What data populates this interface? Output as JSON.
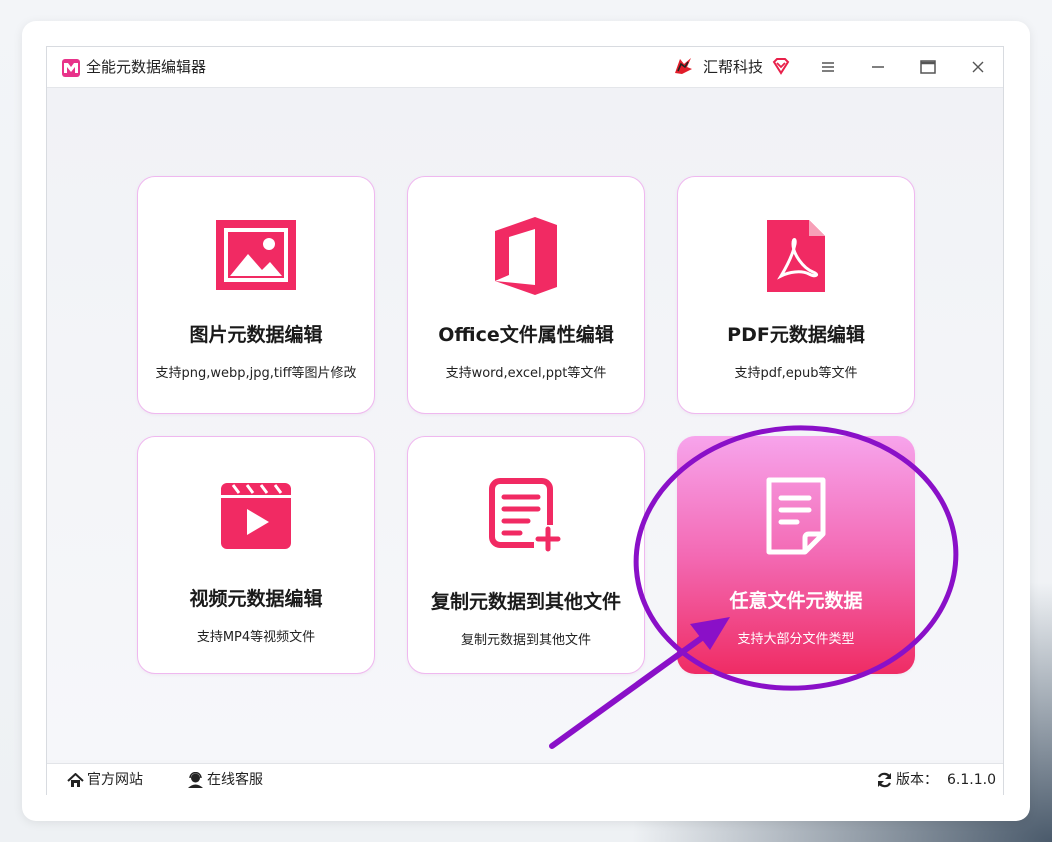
{
  "window": {
    "title": "全能元数据编辑器",
    "brand": "汇帮科技"
  },
  "cards": [
    {
      "title": "图片元数据编辑",
      "desc": "支持png,webp,jpg,tiff等图片修改",
      "icon": "image-icon"
    },
    {
      "title": "Office文件属性编辑",
      "desc": "支持word,excel,ppt等文件",
      "icon": "office-icon"
    },
    {
      "title": "PDF元数据编辑",
      "desc": "支持pdf,epub等文件",
      "icon": "pdf-icon"
    },
    {
      "title": "视频元数据编辑",
      "desc": "支持MP4等视频文件",
      "icon": "video-icon"
    },
    {
      "title": "复制元数据到其他文件",
      "desc": "复制元数据到其他文件",
      "icon": "copy-doc-icon"
    },
    {
      "title": "任意文件元数据",
      "desc": "支持大部分文件类型",
      "icon": "file-icon"
    }
  ],
  "statusbar": {
    "website": "官方网站",
    "support": "在线客服",
    "version_label": "版本：",
    "version": "6.1.1.0"
  },
  "colors": {
    "accent": "#f0306a",
    "card_border": "#efb8ef",
    "annotation": "#8a10c8"
  }
}
